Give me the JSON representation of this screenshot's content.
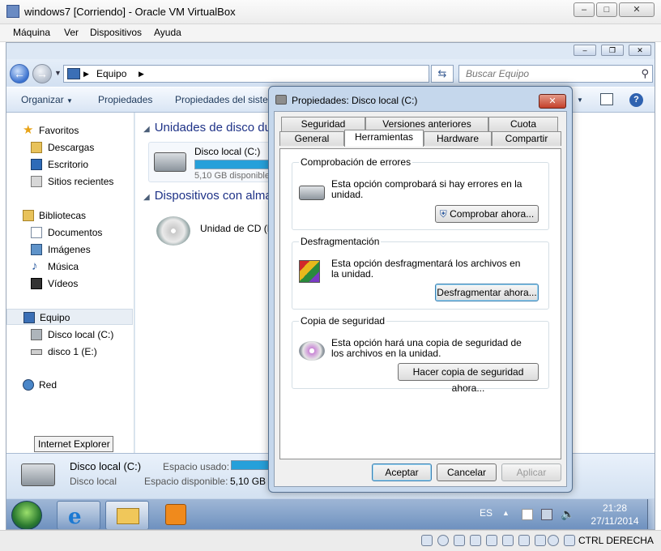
{
  "host": {
    "title": "windows7 [Corriendo] - Oracle VM VirtualBox",
    "menu": [
      "Máquina",
      "Ver",
      "Dispositivos",
      "Ayuda"
    ],
    "status_right": "CTRL DERECHA"
  },
  "explorer": {
    "address": {
      "crumb": "Equipo"
    },
    "search_placeholder": "Buscar Equipo",
    "commands": {
      "organize": "Organizar",
      "properties": "Propiedades",
      "system_properties": "Propiedades del sistema"
    },
    "nav": {
      "favorites": "Favoritos",
      "downloads": "Descargas",
      "desktop": "Escritorio",
      "recent": "Sitios recientes",
      "libraries": "Bibliotecas",
      "documents": "Documentos",
      "pictures": "Imágenes",
      "music": "Música",
      "videos": "Vídeos",
      "computer": "Equipo",
      "local_disk": "Disco local (C:)",
      "disk1": "disco 1 (E:)",
      "network": "Red"
    },
    "groups": {
      "hdd": "Unidades de disco duro",
      "removable": "Dispositivos con almacenamiento extraíble"
    },
    "items": {
      "local_disk": "Disco local (C:)",
      "local_free": "5,10 GB disponibles",
      "cd": "Unidad de CD (D:)"
    },
    "details": {
      "name": "Disco local (C:)",
      "subtitle": "Disco local",
      "used_label": "Espacio usado:",
      "free_label": "Espacio disponible:",
      "free_value": "5,10 GB"
    }
  },
  "taskbar": {
    "tooltip": "Internet Explorer",
    "lang": "ES",
    "time": "21:28",
    "date": "27/11/2014"
  },
  "dialog": {
    "title": "Propiedades: Disco local (C:)",
    "tabs_row1": [
      "Seguridad",
      "Versiones anteriores",
      "Cuota"
    ],
    "tabs_row2": [
      "General",
      "Herramientas",
      "Hardware",
      "Compartir"
    ],
    "selected_tab": "Herramientas",
    "sections": {
      "check": {
        "legend": "Comprobación de errores",
        "desc": "Esta opción comprobará si hay errores en la unidad.",
        "button": "Comprobar ahora..."
      },
      "defrag": {
        "legend": "Desfragmentación",
        "desc": "Esta opción desfragmentará los archivos en la unidad.",
        "button": "Desfragmentar ahora..."
      },
      "backup": {
        "legend": "Copia de seguridad",
        "desc": "Esta opción hará una copia de seguridad de los archivos en la unidad.",
        "button": "Hacer copia de seguridad ahora..."
      }
    },
    "buttons": {
      "ok": "Aceptar",
      "cancel": "Cancelar",
      "apply": "Aplicar"
    }
  }
}
